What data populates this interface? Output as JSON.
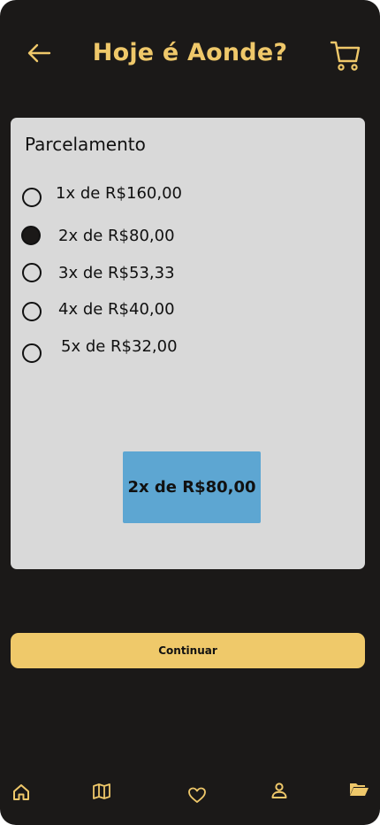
{
  "colors": {
    "background": "#1b1918",
    "accent": "#efc86a",
    "card": "#d9d9d9",
    "summary": "#5da6d2"
  },
  "header": {
    "title": "Hoje é Aonde?",
    "back_icon": "arrow-left-icon",
    "cart_icon": "cart-icon"
  },
  "installments": {
    "title": "Parcelamento",
    "options": [
      {
        "label": "1x de R$160,00",
        "selected": false
      },
      {
        "label": "2x de R$80,00",
        "selected": true
      },
      {
        "label": "3x de R$53,33",
        "selected": false
      },
      {
        "label": "4x de R$40,00",
        "selected": false
      },
      {
        "label": "5x de R$32,00",
        "selected": false
      }
    ],
    "summary": "2x de R$80,00"
  },
  "continue_label": "Continuar",
  "bottom_nav": {
    "items": [
      {
        "icon": "home-icon"
      },
      {
        "icon": "map-icon"
      },
      {
        "icon": "heart-icon"
      },
      {
        "icon": "user-icon"
      },
      {
        "icon": "folder-icon"
      }
    ]
  }
}
